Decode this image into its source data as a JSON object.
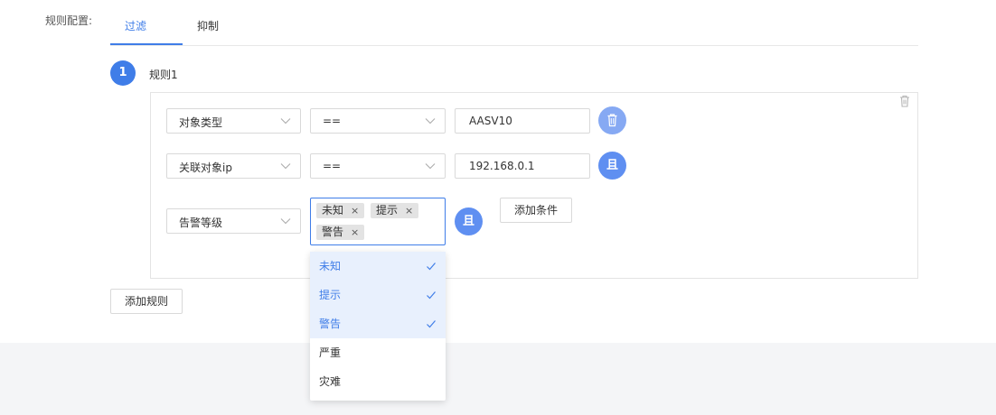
{
  "form": {
    "config_label": "规则配置:"
  },
  "tabs": [
    {
      "label": "过滤",
      "active": true
    },
    {
      "label": "抑制",
      "active": false
    }
  ],
  "rule": {
    "index": "1",
    "title": "规则1"
  },
  "conditions": [
    {
      "field": "对象类型",
      "operator": "==",
      "value": "AASV10",
      "action_icon": "trash-icon"
    },
    {
      "field": "关联对象ip",
      "operator": "==",
      "value": "192.168.0.1",
      "action_icon": "and-icon",
      "action_text": "且"
    },
    {
      "field": "告警等级",
      "selected_tags": [
        "未知",
        "提示",
        "警告"
      ],
      "action_icon": "and-icon",
      "action_text": "且"
    }
  ],
  "buttons": {
    "add_condition": "添加条件",
    "add_rule": "添加规则"
  },
  "dropdown": {
    "options": [
      {
        "label": "未知",
        "selected": true
      },
      {
        "label": "提示",
        "selected": true
      },
      {
        "label": "警告",
        "selected": true
      },
      {
        "label": "严重",
        "selected": false
      },
      {
        "label": "灾难",
        "selected": false
      }
    ]
  },
  "colors": {
    "accent": "#3f7de8",
    "circle_button": "#5f8ff1",
    "selected_option_bg": "#e8f0fd",
    "footer_bg": "#f4f5f7"
  }
}
